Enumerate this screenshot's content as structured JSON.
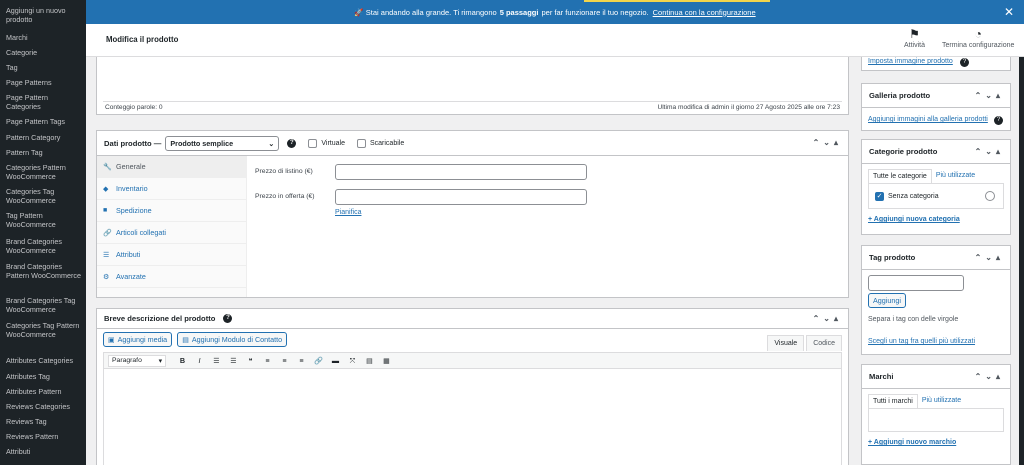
{
  "sidebar": {
    "items": [
      "Aggiungi un nuovo prodotto",
      "Marchi",
      "Categorie",
      "Tag",
      "Page Patterns",
      "Page Pattern Categories",
      "Page Pattern Tags",
      "Pattern Category",
      "Pattern Tag",
      "Categories Pattern WooCommerce",
      "Categories Tag WooCommerce",
      "Tag Pattern WooCommerce",
      "Brand Categories WooCommerce",
      "Brand Categories Pattern WooCommerce",
      "Brand Categories Tag WooCommerce",
      "Categories Tag Pattern WooCommerce",
      "Attributes Categories",
      "Attributes Tag",
      "Attributes Pattern",
      "Reviews Categories",
      "Reviews Tag",
      "Reviews Pattern",
      "Attributi"
    ]
  },
  "notice": {
    "prefix": "🚀 Stai andando alla grande. Ti rimangono",
    "bold": "5 passaggi",
    "suffix": "per far funzionare il tuo negozio.",
    "link": "Continua con la configurazione",
    "close": "✕"
  },
  "header": {
    "title": "Modifica il prodotto",
    "activity_label": "Attività",
    "finish_label": "Termina configurazione"
  },
  "editor_status": {
    "word_count": "Conteggio parole: 0",
    "last_modified": "Ultima modifica di admin il giorno 27 Agosto 2025 alle ore 7:23"
  },
  "product_data": {
    "title": "Dati prodotto —",
    "type_value": "Prodotto semplice",
    "virtual_label": "Virtuale",
    "downloadable_label": "Scaricabile",
    "tabs": [
      "Generale",
      "Inventario",
      "Spedizione",
      "Articoli collegati",
      "Attributi",
      "Avanzate"
    ],
    "regular_price_label": "Prezzo di listino (€)",
    "sale_price_label": "Prezzo in offerta (€)",
    "schedule_link": "Pianifica"
  },
  "short_description": {
    "title": "Breve descrizione del prodotto",
    "add_media": "Aggiungi media",
    "add_contact_form": "Aggiungi Modulo di Contatto",
    "tab_visual": "Visuale",
    "tab_code": "Codice",
    "format_select": "Paragrafo"
  },
  "sidebar_right": {
    "set_image_link": "Imposta immagine prodotto",
    "gallery_title": "Galleria prodotto",
    "gallery_link": "Aggiungi immagini alla galleria prodotti",
    "categories_title": "Categorie prodotto",
    "categories_tab_all": "Tutte le categorie",
    "categories_tab_popular": "Più utilizzate",
    "category_item": "Senza categoria",
    "add_category_link": "+ Aggiungi nuova categoria",
    "tags_title": "Tag prodotto",
    "tags_add_button": "Aggiungi",
    "tags_hint": "Separa i tag con delle virgole",
    "tags_choose_link": "Scegli un tag fra quelli più utilizzati",
    "brands_title": "Marchi",
    "brands_tab_all": "Tutti i marchi",
    "brands_tab_popular": "Più utilizzate",
    "add_brand_link": "+ Aggiungi nuovo marchio"
  }
}
